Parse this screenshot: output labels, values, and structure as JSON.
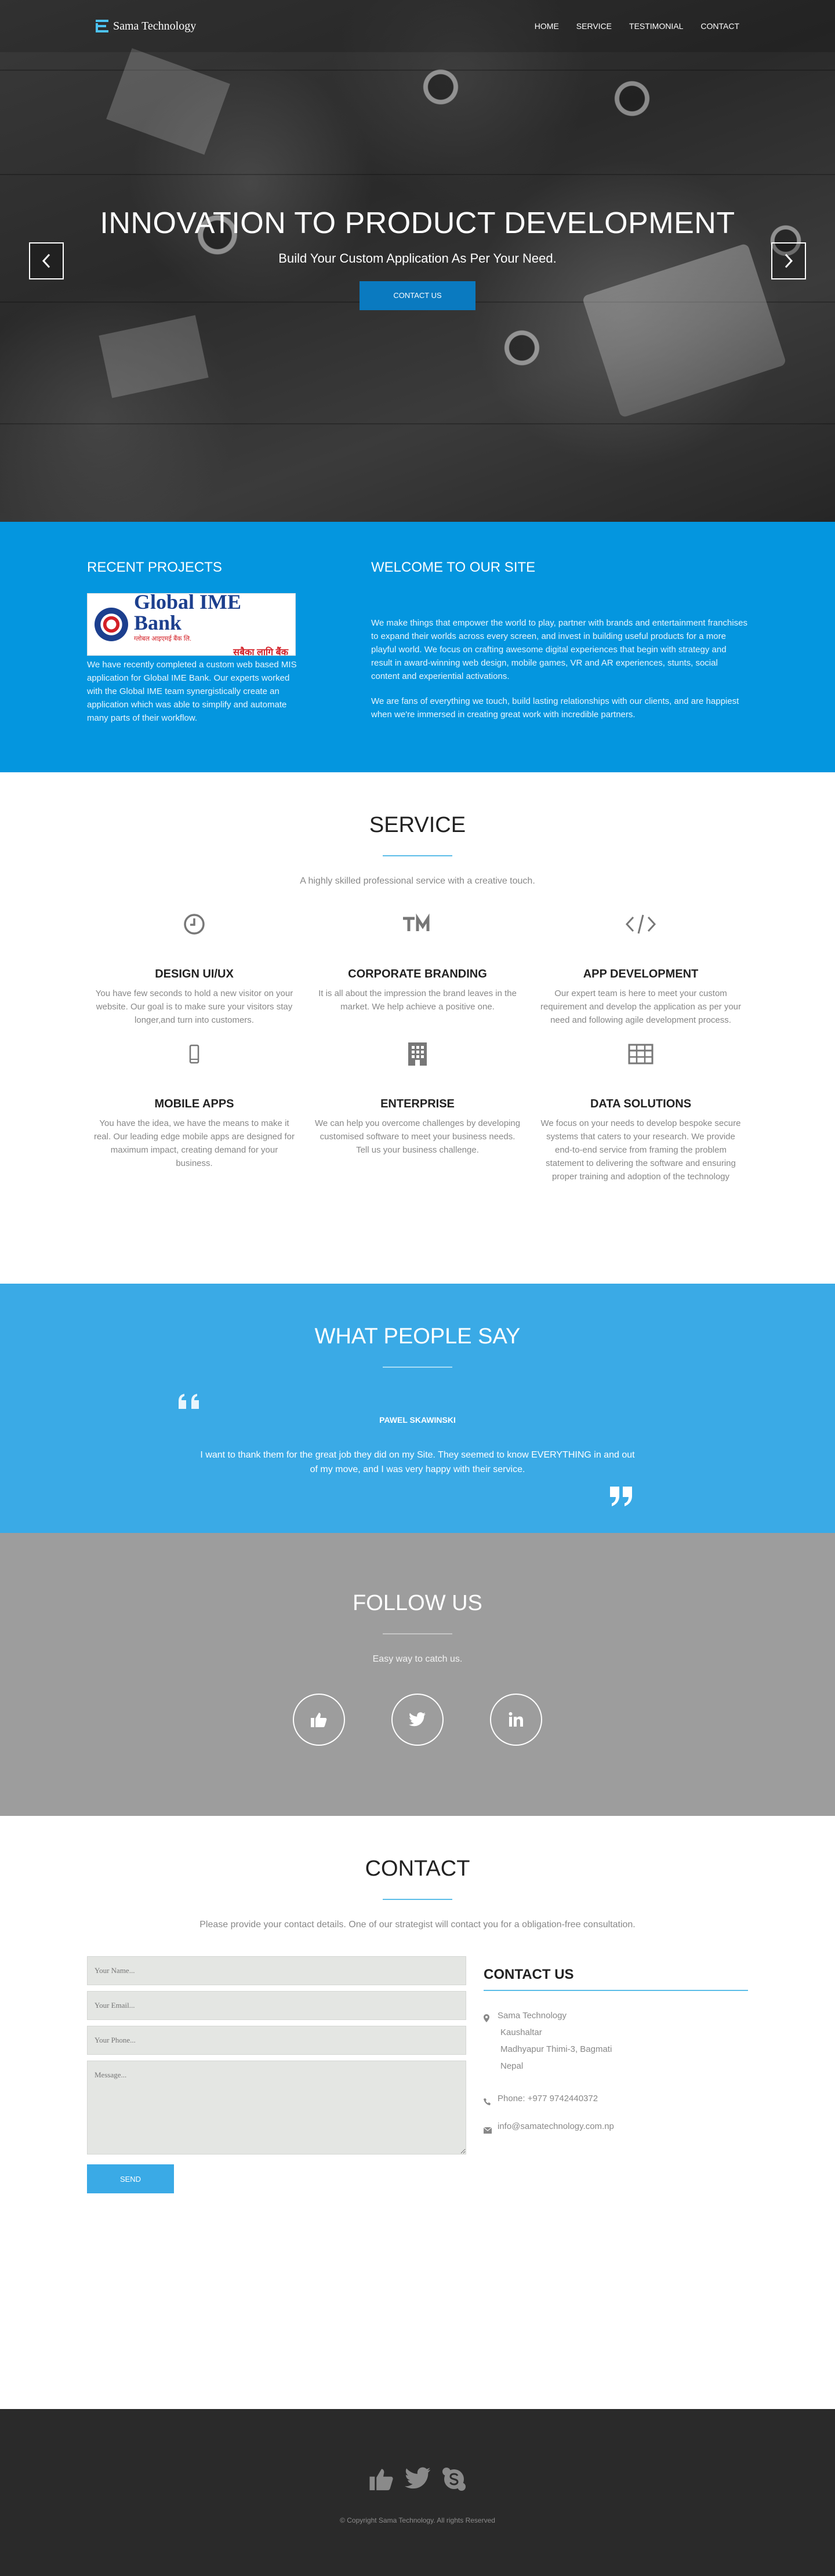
{
  "header": {
    "brand": "Sama Technology",
    "nav": [
      "HOME",
      "SERVICE",
      "TESTIMONIAL",
      "CONTACT"
    ]
  },
  "hero": {
    "title": "INNOVATION TO PRODUCT DEVELOPMENT",
    "subtitle": "Build Your Custom Application As Per Your Need.",
    "cta": "CONTACT US"
  },
  "projects": {
    "heading": "RECENT PROJECTS",
    "logo": {
      "name": "Global IME Bank",
      "tagline": "ग्लोबल आइएमई बैंक लि.",
      "slogan": "सबैका लागि बैंक"
    },
    "text": "We have recently completed a custom web based MIS application for Global IME Bank. Our experts worked with the Global IME team synergistically create an application which was able to simplify and automate many parts of their workflow."
  },
  "welcome": {
    "heading": "WELCOME TO OUR SITE",
    "p1": "We make things that empower the world to play, partner with brands and entertainment franchises to expand their worlds across every screen, and invest in building useful products for a more playful world. We focus on crafting awesome digital experiences that begin with strategy and result in award-winning web design, mobile games, VR and AR experiences, stunts, social content and experiential activations.",
    "p2": "We are fans of everything we touch, build lasting relationships with our clients, and are happiest when we're immersed in creating great work with incredible partners."
  },
  "service": {
    "heading": "SERVICE",
    "lead": "A highly skilled professional service with a creative touch.",
    "items": [
      {
        "icon": "clock-icon",
        "title": "DESIGN UI/UX",
        "desc": "You have few seconds to hold a new visitor on your website. Our goal is to make sure your visitors stay longer,and turn into customers."
      },
      {
        "icon": "trademark-icon",
        "title": "CORPORATE BRANDING",
        "desc": "It is all about the impression the brand leaves in the market. We help achieve a positive one."
      },
      {
        "icon": "code-icon",
        "title": "APP DEVELOPMENT",
        "desc": "Our expert team is here to meet your custom requirement and develop the application as per your need and following agile development process."
      },
      {
        "icon": "mobile-icon",
        "title": "MOBILE APPS",
        "desc": "You have the idea, we have the means to make it real. Our leading edge mobile apps are designed for maximum impact, creating demand for your business."
      },
      {
        "icon": "building-icon",
        "title": "ENTERPRISE",
        "desc": "We can help you overcome challenges by developing customised software to meet your business needs. Tell us your business challenge."
      },
      {
        "icon": "table-icon",
        "title": "DATA SOLUTIONS",
        "desc": "We focus on your needs to develop bespoke secure systems that caters to your research. We provide end-to-end service from framing the problem statement to delivering the software and ensuring proper training and adoption of the technology"
      }
    ]
  },
  "testimonial": {
    "heading": "WHAT PEOPLE SAY",
    "name": "PAWEL SKAWINSKI",
    "text": "I want to thank them for the great job they did on my Site. They seemed to know EVERYTHING in and out of my move, and I was very happy with their service."
  },
  "follow": {
    "heading": "FOLLOW US",
    "lead": "Easy way to catch us.",
    "socials": [
      "facebook-like-icon",
      "twitter-icon",
      "linkedin-icon"
    ]
  },
  "contact": {
    "heading": "CONTACT",
    "lead": "Please provide your contact details. One of our strategist will contact you for a obligation-free consultation.",
    "form": {
      "name_placeholder": "Your Name...",
      "email_placeholder": "Your Email...",
      "phone_placeholder": "Your Phone...",
      "message_placeholder": "Message...",
      "send": "SEND"
    },
    "info": {
      "heading": "CONTACT US",
      "address": [
        "Sama Technology",
        "Kaushaltar",
        "Madhyapur Thimi-3, Bagmati",
        "Nepal"
      ],
      "phone": "Phone: +977 9742440372",
      "email": "info@samatechnology.com.np"
    }
  },
  "footer": {
    "icons": [
      "thumbs-up-icon",
      "twitter-icon",
      "skype-icon"
    ],
    "copyright": "© Copyright Sama Technology. All rights Reserved"
  },
  "colors": {
    "accent": "#0496df",
    "testimonial_bg": "#3aaae6",
    "follow_bg": "#9d9d9d",
    "footer_bg": "#2a2a2a"
  }
}
